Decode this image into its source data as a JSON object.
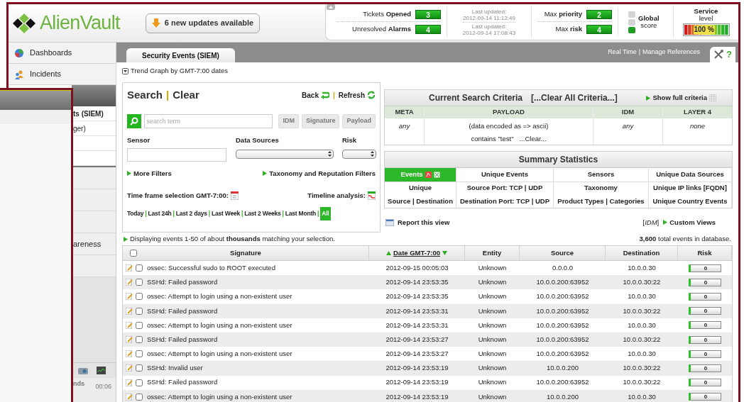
{
  "header": {
    "logo": "AlienVault",
    "updates": "6 new updates available",
    "tickets": [
      {
        "label": "Tickets **Opened**",
        "value": "3"
      },
      {
        "label": "Unresolved **Alarms**",
        "value": "4"
      }
    ],
    "last_updated": [
      {
        "label": "Last updated:",
        "time": "2012-09-14 11:12:49"
      },
      {
        "label": "Last updated:",
        "time": "2012-09-14 17:08:43"
      }
    ],
    "risk": [
      {
        "label": "Max **priority**",
        "value": "2"
      },
      {
        "label": "Max **risk**",
        "value": "4"
      }
    ],
    "global": {
      "title": "Global",
      "subtitle": "score",
      "lights": [
        {
          "on": false
        },
        {
          "on": false
        },
        {
          "on": true
        }
      ]
    },
    "service": {
      "title": "Service",
      "subtitle": "level",
      "reading": "100 %"
    }
  },
  "sidebar": {
    "items": [
      {
        "label": "Dashboards"
      },
      {
        "label": "Incidents"
      }
    ],
    "subitems": [
      {
        "label": "ts (SIEM)",
        "selected": true
      },
      {
        "label": "ger)",
        "selected": false
      }
    ],
    "sections": [
      "areness"
    ],
    "footer": {
      "label": "nds",
      "time": "00:06"
    }
  },
  "tabs": [
    {
      "label": "Security Events (SIEM)",
      "selected": true
    }
  ],
  "top_links": [
    "Real Time",
    "Manage References"
  ],
  "separator": "|",
  "help": "?",
  "trend": "Trend Graph by GMT-7:00 dates",
  "search": {
    "title": "Search",
    "clear": "Clear",
    "back": "Back",
    "refresh": "Refresh",
    "placeholder": "search term",
    "modes": [
      "IDM",
      "Signature",
      "Payload"
    ],
    "sensor": "Sensor",
    "data_sources": "Data Sources",
    "risk": "Risk",
    "more_filters": "More Filters",
    "taxonomy_filters": "Taxonomy and Reputation Filters",
    "time_frame": "Time frame selection GMT-7:00:",
    "timeline": "Timeline analysis:",
    "ranges": [
      {
        "label": "Today",
        "selected": false
      },
      {
        "label": "Last 24h",
        "selected": false
      },
      {
        "label": "Last 2 days",
        "selected": false
      },
      {
        "label": "Last Week",
        "selected": false
      },
      {
        "label": "Last 2 Weeks",
        "selected": false
      },
      {
        "label": "Last Month",
        "selected": false
      },
      {
        "label": "All",
        "selected": true
      }
    ]
  },
  "criteria": {
    "title": "Current Search Criteria",
    "clear_all": "[...Clear All Criteria...]",
    "show_full": "Show full criteria",
    "columns": [
      "META",
      "PAYLOAD",
      "IDM",
      "LAYER 4"
    ],
    "meta": "any",
    "payload": "(data encoded as => ascii)",
    "payload_match": "contains \"test\"",
    "payload_clear": "...Clear...",
    "idm": "any",
    "layer4": "none"
  },
  "summary": {
    "title": "Summary Statistics",
    "tabs": [
      {
        "label": "Events",
        "selected": true
      },
      {
        "label": "Unique Events",
        "selected": false
      },
      {
        "label": "Sensors",
        "selected": false
      },
      {
        "label": "Unique Data Sources",
        "selected": false
      }
    ],
    "links": [
      [
        "Unique",
        "Source | Destination"
      ],
      [
        "Source Port: TCP | UDP",
        "Destination Port: TCP | UDP"
      ],
      [
        "Taxonomy",
        "Product Types | Categories"
      ],
      [
        "Unique IP links [FQDN]",
        "Unique Country Events"
      ]
    ],
    "report": "Report this view",
    "idm": "[*IDM*]",
    "custom_views": "Custom Views"
  },
  "displaying": "Displaying events 1-50 of about **thousands** matching your selection.",
  "total": "**3,600** total events in database.",
  "table": {
    "select_all_checked": false,
    "columns": [
      {
        "label": "Signature",
        "sorted": false
      },
      {
        "label": "Date GMT-7:00",
        "sorted": true
      },
      {
        "label": "Entity",
        "sorted": false
      },
      {
        "label": "Source",
        "sorted": false
      },
      {
        "label": "Destination",
        "sorted": false
      },
      {
        "label": "Risk",
        "sorted": false
      }
    ],
    "rows": [
      {
        "checked": false,
        "signature": "ossec: Successful sudo to ROOT executed",
        "date": "2012-09-15 00:05:03",
        "entity": "Unknown",
        "source": "0.0.0.0",
        "destination": "10.0.0.30",
        "risk": "0"
      },
      {
        "checked": false,
        "signature": "SSHd: Failed password",
        "date": "2012-09-14 23:53:35",
        "entity": "Unknown",
        "source": "10.0.0.200:63952",
        "destination": "10.0.0.30:22",
        "risk": "0"
      },
      {
        "checked": false,
        "signature": "ossec: Attempt to login using a non-existent user",
        "date": "2012-09-14 23:53:35",
        "entity": "Unknown",
        "source": "10.0.0.200:63952",
        "destination": "10.0.0.30",
        "risk": "0"
      },
      {
        "checked": false,
        "signature": "SSHd: Failed password",
        "date": "2012-09-14 23:53:31",
        "entity": "Unknown",
        "source": "10.0.0.200:63952",
        "destination": "10.0.0.30:22",
        "risk": "0"
      },
      {
        "checked": false,
        "signature": "ossec: Attempt to login using a non-existent user",
        "date": "2012-09-14 23:53:31",
        "entity": "Unknown",
        "source": "10.0.0.200:63952",
        "destination": "10.0.0.30",
        "risk": "0"
      },
      {
        "checked": false,
        "signature": "SSHd: Failed password",
        "date": "2012-09-14 23:53:27",
        "entity": "Unknown",
        "source": "10.0.0.200:63952",
        "destination": "10.0.0.30:22",
        "risk": "0"
      },
      {
        "checked": false,
        "signature": "ossec: Attempt to login using a non-existent user",
        "date": "2012-09-14 23:53:27",
        "entity": "Unknown",
        "source": "10.0.0.200:63952",
        "destination": "10.0.0.30",
        "risk": "0"
      },
      {
        "checked": false,
        "signature": "SSHd: Invalid user",
        "date": "2012-09-14 23:53:19",
        "entity": "Unknown",
        "source": "10.0.0.200",
        "destination": "10.0.0.30:22",
        "risk": "0"
      },
      {
        "checked": false,
        "signature": "SSHd: Failed password",
        "date": "2012-09-14 23:53:19",
        "entity": "Unknown",
        "source": "10.0.0.200:63952",
        "destination": "10.0.0.30:22",
        "risk": "0"
      },
      {
        "checked": false,
        "signature": "ossec: Attempt to login using a non-existent user",
        "date": "2012-09-14 23:53:19",
        "entity": "Unknown",
        "source": "10.0.0.200",
        "destination": "10.0.0.30",
        "risk": "0"
      }
    ]
  }
}
